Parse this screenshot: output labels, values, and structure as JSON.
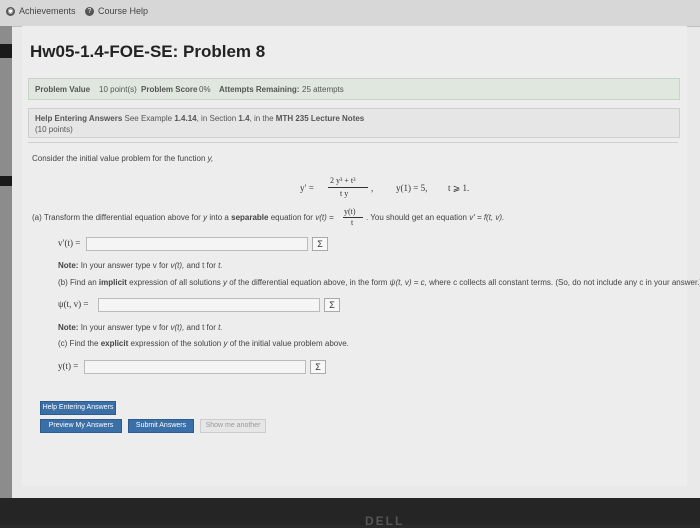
{
  "topbar": {
    "achievements": "Achievements",
    "course_help": "Course Help"
  },
  "page_title": "Hw05-1.4-FOE-SE: Problem 8",
  "problem_info": {
    "value_label": "Problem Value",
    "value": "10 point(s)",
    "score_label": "Problem Score",
    "score": "0%",
    "attempts_label": "Attempts Remaining:",
    "attempts": "25 attempts"
  },
  "help": {
    "label": "Help Entering Answers",
    "text_pre": "See Example",
    "example": "1.4.14",
    "text_mid": ", in Section",
    "section": "1.4",
    "text_mid2": ", in the",
    "notes": "MTH 235 Lecture Notes",
    "points": "(10 points)"
  },
  "question": {
    "intro_pre": "Consider the initial value problem for the function",
    "intro_var": "y,",
    "ode_lhs": "y′ =",
    "ode_num": "2 y³ + t³",
    "ode_den": "t y",
    "ode_comma": ",",
    "ic": "y(1) = 5,",
    "domain": "t ⩾ 1.",
    "part_a_pre": "(a) Transform the differential equation above for",
    "part_a_y": "y",
    "part_a_into": "into a",
    "part_a_bold": "separable",
    "part_a_rest": "equation for",
    "part_a_sub": "v(t) =",
    "part_a_frac_num": "y(t)",
    "part_a_frac_den": "t",
    "part_a_tail": ". You should get an equation",
    "part_a_form": "v′ = f(t, v).",
    "ans_a_label": "v′(t) =",
    "note1_bold": "Note:",
    "note1_text": "In your answer type v for",
    "note1_var": "v(t),",
    "note1_tail": "and t for",
    "note1_t": "t.",
    "part_b_pre": "(b) Find an",
    "part_b_bold": "implicit",
    "part_b_rest": "expression of all solutions",
    "part_b_y": "y",
    "part_b_mid": "of the differential equation above, in the form",
    "part_b_form": "ψ(t, v) = c,",
    "part_b_tail": "where c collects all constant terms. (So, do not include any c in your answer.)",
    "ans_b_label": "ψ(t, v) =",
    "note2_bold": "Note:",
    "note2_text": "In your answer type v for",
    "note2_var": "v(t),",
    "note2_tail": "and t for",
    "note2_t": "t.",
    "part_c_pre": "(c) Find the",
    "part_c_bold": "explicit",
    "part_c_rest": "expression of the solution",
    "part_c_y": "y",
    "part_c_tail": "of the initial value problem above.",
    "ans_c_label": "y(t) =",
    "sigma": "Σ"
  },
  "buttons": {
    "help_entering": "Help Entering Answers",
    "preview": "Preview My Answers",
    "submit": "Submit Answers",
    "show_another": "Show me another"
  },
  "bezel_logo": "DELL"
}
